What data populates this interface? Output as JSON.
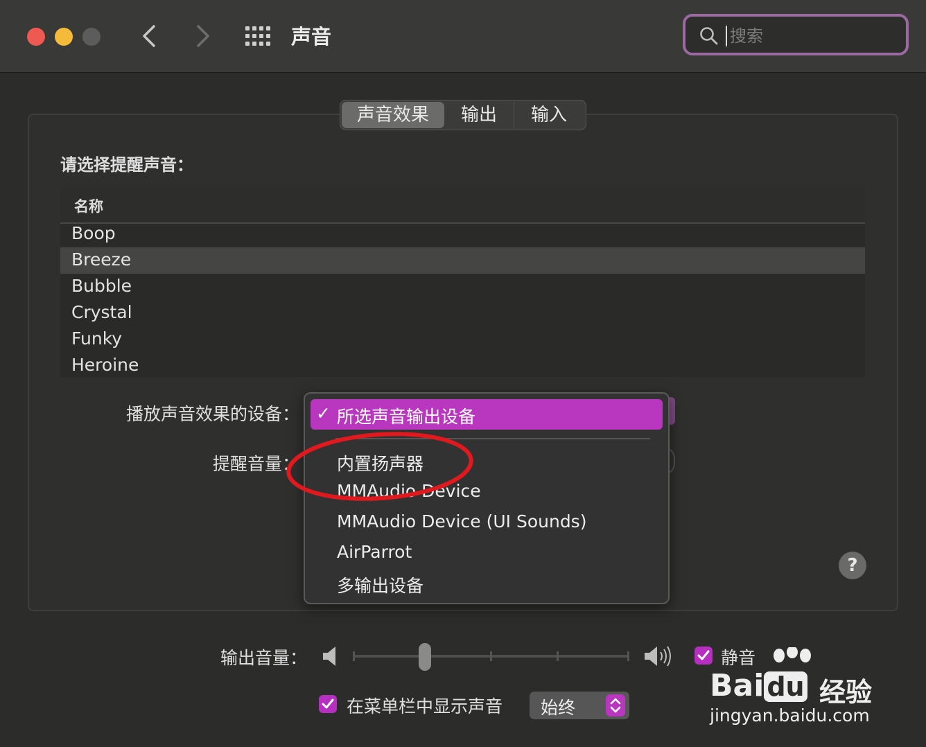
{
  "window": {
    "title": "声音"
  },
  "search": {
    "placeholder": "搜索"
  },
  "tabs": [
    {
      "label": "声音效果",
      "active": true
    },
    {
      "label": "输出",
      "active": false
    },
    {
      "label": "输入",
      "active": false
    }
  ],
  "alert_section": {
    "label": "请选择提醒声音：",
    "column_header": "名称",
    "sounds": [
      "Boop",
      "Breeze",
      "Bubble",
      "Crystal",
      "Funky",
      "Heroine"
    ],
    "selected": "Breeze"
  },
  "play_device": {
    "label": "播放声音效果的设备：",
    "menu": {
      "selected": "所选声音输出设备",
      "check": "✓",
      "options": [
        "内置扬声器",
        "MMAudio Device",
        "MMAudio Device (UI Sounds)",
        "AirParrot",
        "多输出设备"
      ]
    }
  },
  "alert_volume": {
    "label": "提醒音量："
  },
  "help": {
    "label": "?"
  },
  "output_volume": {
    "label": "输出音量：",
    "level": 0.26
  },
  "mute": {
    "label": "静音",
    "checked": true
  },
  "show_in_menubar": {
    "label": "在菜单栏中显示声音",
    "checked": true,
    "option": "始终"
  },
  "watermark": {
    "brand": "Bai",
    "brand2": "du",
    "cn": "经验",
    "url": "jingyan.baidu.com"
  },
  "colors": {
    "accent": "#b936be",
    "annotation": "#e0191e",
    "search_focus": "#9a6aa0"
  },
  "icons": [
    "back-chevron-icon",
    "forward-chevron-icon",
    "grid-icon",
    "search-icon",
    "speaker-low-icon",
    "speaker-high-icon",
    "checkmark-icon",
    "updown-arrows-icon"
  ]
}
